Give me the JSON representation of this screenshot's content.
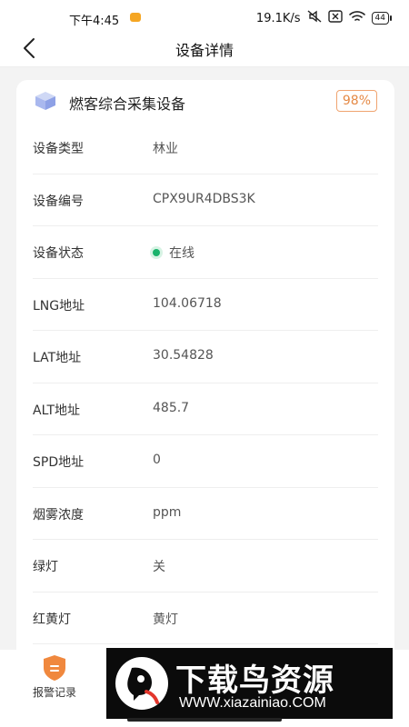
{
  "status_bar": {
    "time": "下午4:45",
    "network_speed": "19.1K/s",
    "battery": "44"
  },
  "nav": {
    "title": "设备详情"
  },
  "device": {
    "name": "燃客综合采集设备",
    "percent": "98%",
    "fields": [
      {
        "label": "设备类型",
        "value": "林业"
      },
      {
        "label": "设备编号",
        "value": "CPX9UR4DBS3K"
      },
      {
        "label": "设备状态",
        "value": "在线"
      },
      {
        "label": "LNG地址",
        "value": "104.06718"
      },
      {
        "label": "LAT地址",
        "value": "30.54828"
      },
      {
        "label": "ALT地址",
        "value": "485.7"
      },
      {
        "label": "SPD地址",
        "value": "0"
      },
      {
        "label": "烟雾浓度",
        "value": "ppm"
      },
      {
        "label": "绿灯",
        "value": "关"
      },
      {
        "label": "红黄灯",
        "value": "黄灯"
      }
    ]
  },
  "bottom_nav": {
    "alarm_label": "报警记录"
  },
  "watermark": {
    "title": "下载鸟资源",
    "url": "WWW.xiazainiao.COM"
  },
  "colors": {
    "accent_orange": "#e58a46",
    "online_green": "#19b36b"
  }
}
